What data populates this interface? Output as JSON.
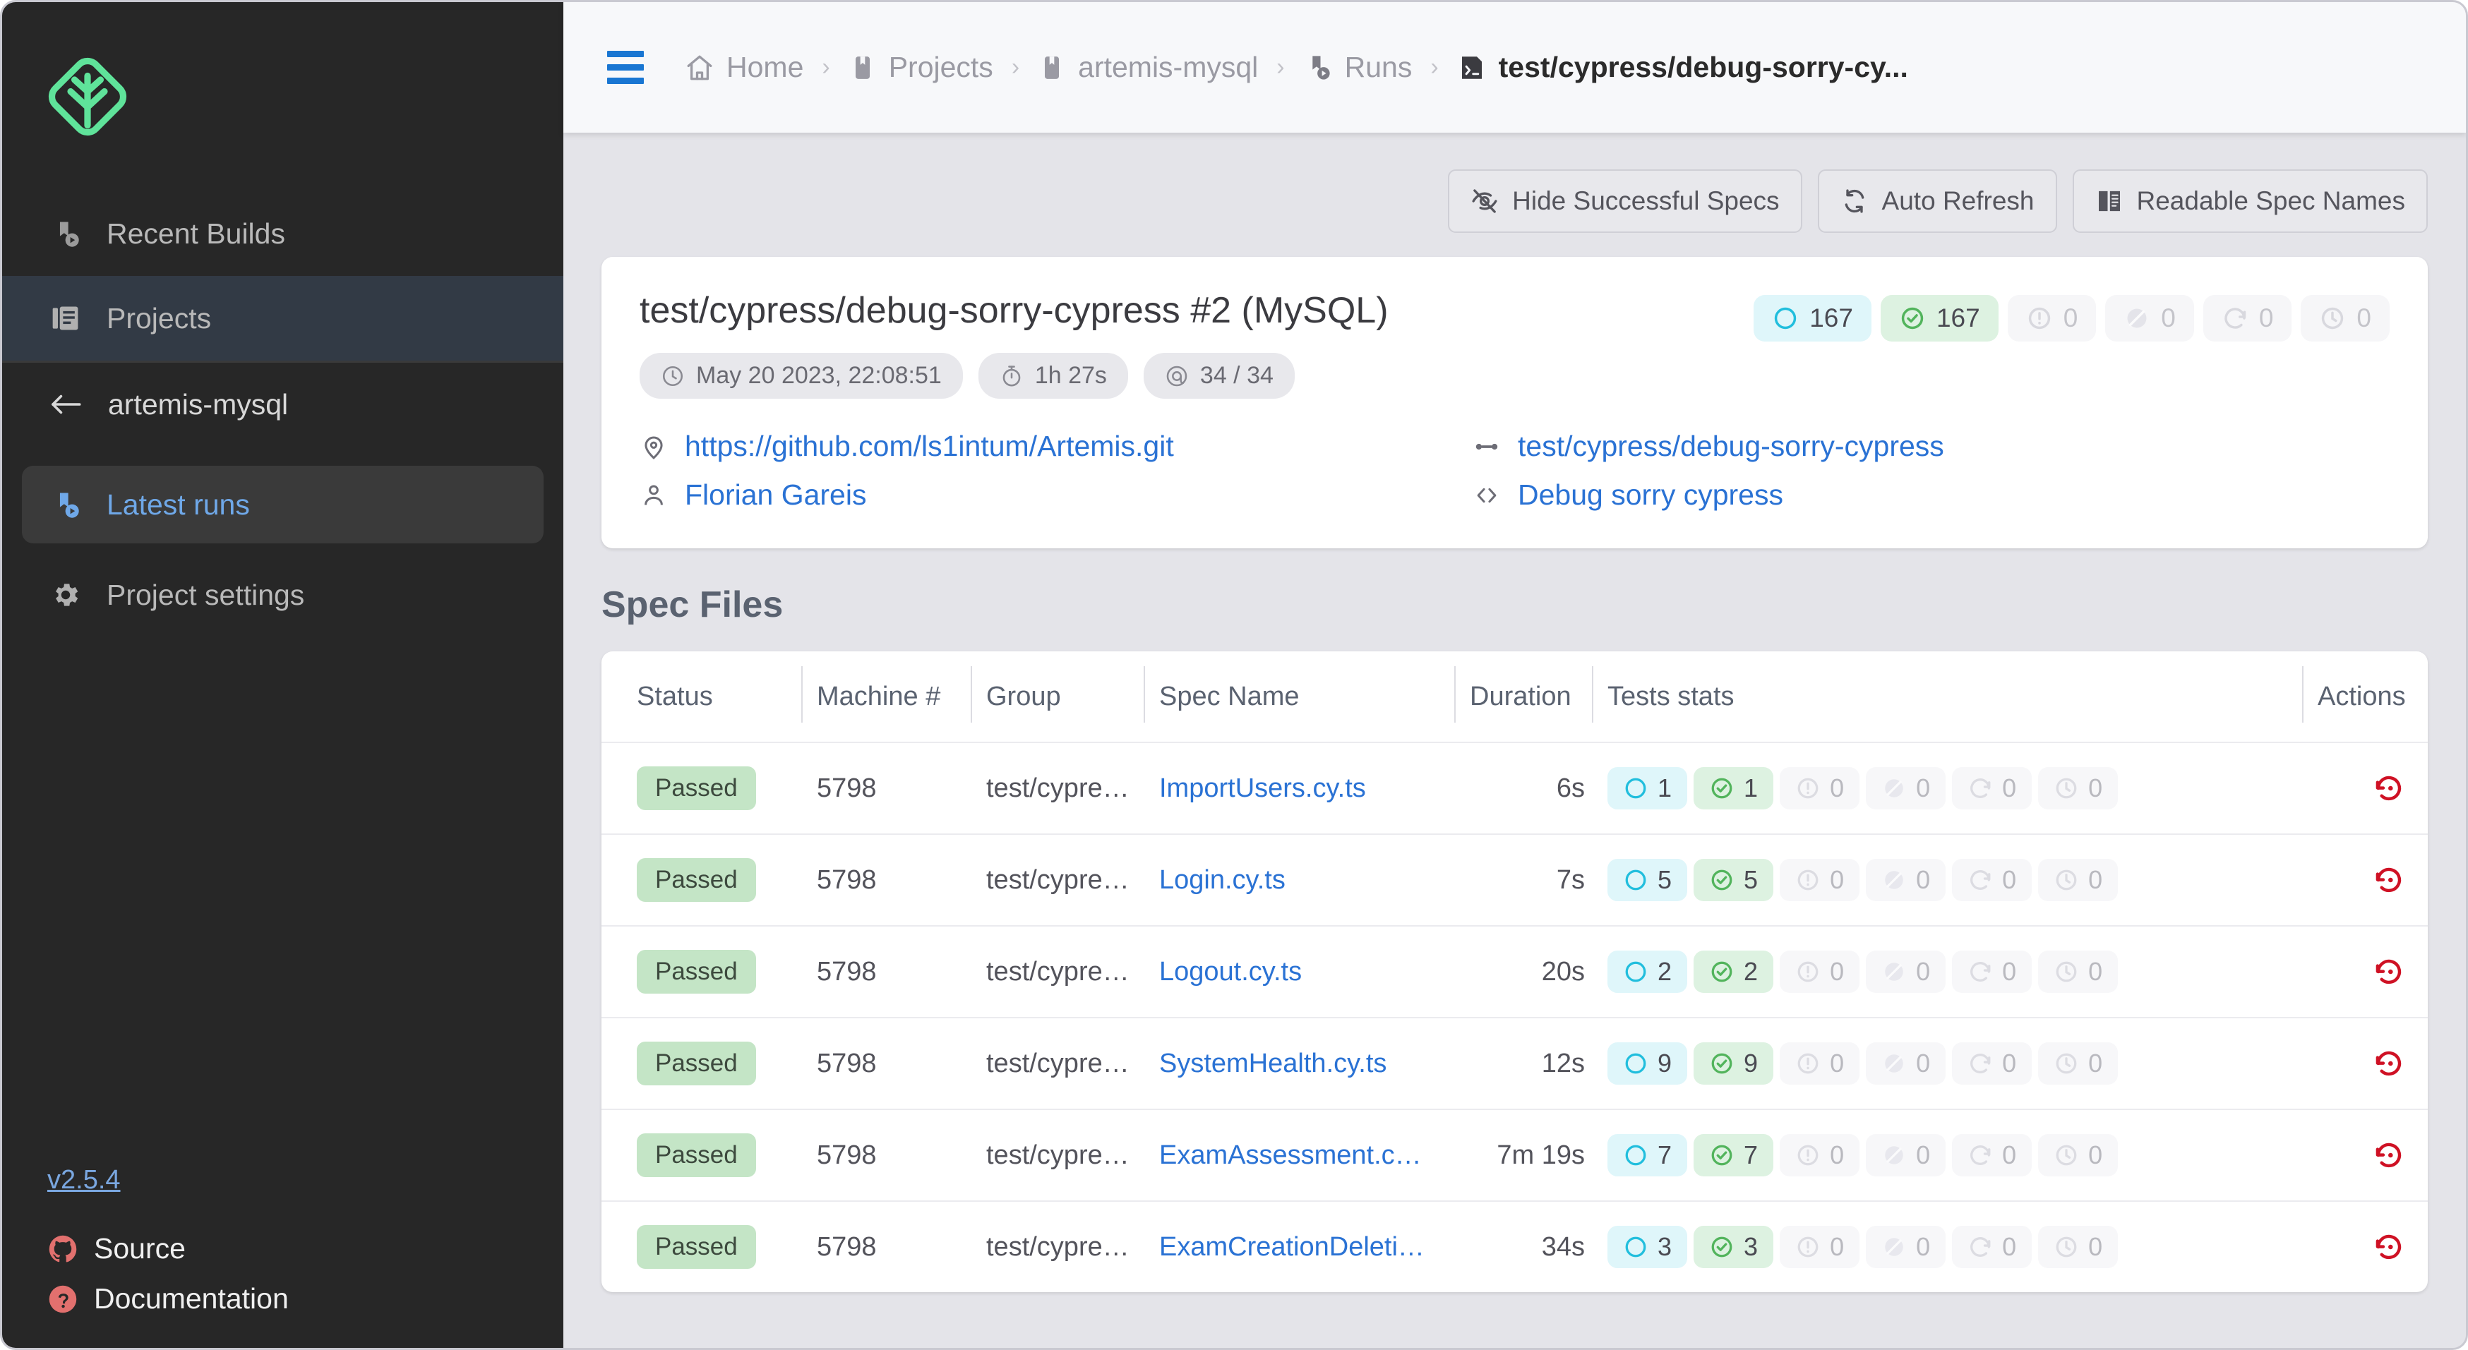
{
  "sidebar": {
    "logo_name": "sorry-cypress-logo",
    "nav": [
      {
        "label": "Recent Builds",
        "icon": "builds-icon",
        "active": false
      },
      {
        "label": "Projects",
        "icon": "projects-icon",
        "active": true
      }
    ],
    "back_label": "artemis-mysql",
    "project_items": [
      {
        "label": "Latest runs",
        "icon": "latest-runs-icon",
        "selected": true
      },
      {
        "label": "Project settings",
        "icon": "gear-icon",
        "selected": false
      }
    ],
    "version": "v2.5.4",
    "footer_links": [
      {
        "label": "Source",
        "icon": "github-icon"
      },
      {
        "label": "Documentation",
        "icon": "question-icon"
      }
    ]
  },
  "topbar": {
    "menu_icon": "hamburger-icon",
    "breadcrumbs": [
      {
        "label": "Home",
        "icon": "home-icon",
        "current": false
      },
      {
        "label": "Projects",
        "icon": "project-icon",
        "current": false
      },
      {
        "label": "artemis-mysql",
        "icon": "project-icon",
        "current": false
      },
      {
        "label": "Runs",
        "icon": "runs-icon",
        "current": false
      },
      {
        "label": "test/cypress/debug-sorry-cy...",
        "icon": "spec-icon",
        "current": true
      }
    ],
    "separator": "›"
  },
  "toolbar": {
    "buttons": [
      {
        "label": "Hide Successful Specs",
        "icon": "eye-off-icon"
      },
      {
        "label": "Auto Refresh",
        "icon": "refresh-icon"
      },
      {
        "label": "Readable Spec Names",
        "icon": "book-icon"
      }
    ]
  },
  "run": {
    "title": "test/cypress/debug-sorry-cypress #2 (MySQL)",
    "meta": [
      {
        "icon": "clock-icon",
        "label": "May 20 2023, 22:08:51"
      },
      {
        "icon": "timer-icon",
        "label": "1h 27s"
      },
      {
        "icon": "target-icon",
        "label": "34 / 34"
      }
    ],
    "stats": [
      {
        "icon": "circle-icon",
        "value": "167",
        "tone": "cyan"
      },
      {
        "icon": "check-circle-icon",
        "value": "167",
        "tone": "green"
      },
      {
        "icon": "alert-circle-icon",
        "value": "0",
        "tone": "muted"
      },
      {
        "icon": "skip-circle-icon",
        "value": "0",
        "tone": "muted"
      },
      {
        "icon": "retry-circle-icon",
        "value": "0",
        "tone": "muted"
      },
      {
        "icon": "clock-circle-icon",
        "value": "0",
        "tone": "muted"
      }
    ],
    "links": [
      {
        "icon": "location-icon",
        "label": "https://github.com/ls1intum/Artemis.git",
        "col": 1
      },
      {
        "icon": "branch-icon",
        "label": "test/cypress/debug-sorry-cypress",
        "col": 2
      },
      {
        "icon": "user-icon",
        "label": "Florian Gareis",
        "col": 1
      },
      {
        "icon": "code-icon",
        "label": "Debug sorry cypress",
        "col": 2
      }
    ]
  },
  "spec_files": {
    "section_title": "Spec Files",
    "columns": [
      {
        "label": "Status",
        "bordered": false
      },
      {
        "label": "Machine #",
        "bordered": true
      },
      {
        "label": "Group",
        "bordered": true
      },
      {
        "label": "Spec Name",
        "bordered": true
      },
      {
        "label": "Duration",
        "bordered": true
      },
      {
        "label": "Tests stats",
        "bordered": true
      },
      {
        "label": "Actions",
        "bordered": true
      }
    ],
    "rows": [
      {
        "status": "Passed",
        "machine": "5798",
        "group": "test/cypre…",
        "spec": "ImportUsers.cy.ts",
        "duration": "6s",
        "stats": [
          "1",
          "1",
          "0",
          "0",
          "0",
          "0"
        ],
        "action_icon": "replay-icon"
      },
      {
        "status": "Passed",
        "machine": "5798",
        "group": "test/cypre…",
        "spec": "Login.cy.ts",
        "duration": "7s",
        "stats": [
          "5",
          "5",
          "0",
          "0",
          "0",
          "0"
        ],
        "action_icon": "replay-icon"
      },
      {
        "status": "Passed",
        "machine": "5798",
        "group": "test/cypre…",
        "spec": "Logout.cy.ts",
        "duration": "20s",
        "stats": [
          "2",
          "2",
          "0",
          "0",
          "0",
          "0"
        ],
        "action_icon": "replay-icon"
      },
      {
        "status": "Passed",
        "machine": "5798",
        "group": "test/cypre…",
        "spec": "SystemHealth.cy.ts",
        "duration": "12s",
        "stats": [
          "9",
          "9",
          "0",
          "0",
          "0",
          "0"
        ],
        "action_icon": "replay-icon"
      },
      {
        "status": "Passed",
        "machine": "5798",
        "group": "test/cypre…",
        "spec": "ExamAssessment.c…",
        "duration": "7m 19s",
        "stats": [
          "7",
          "7",
          "0",
          "0",
          "0",
          "0"
        ],
        "action_icon": "replay-icon"
      },
      {
        "status": "Passed",
        "machine": "5798",
        "group": "test/cypre…",
        "spec": "ExamCreationDeleti…",
        "duration": "34s",
        "stats": [
          "3",
          "3",
          "0",
          "0",
          "0",
          "0"
        ],
        "action_icon": "replay-icon"
      }
    ]
  },
  "colors": {
    "sidebar_bg": "#272727",
    "accent_blue": "#2a72d4",
    "logo_green": "#5fe39a",
    "passed_green": "#c4e5c6",
    "stat_cyan": "#dff6fa",
    "replay_red": "#cf1124",
    "page_bg": "#e4e4e9"
  }
}
